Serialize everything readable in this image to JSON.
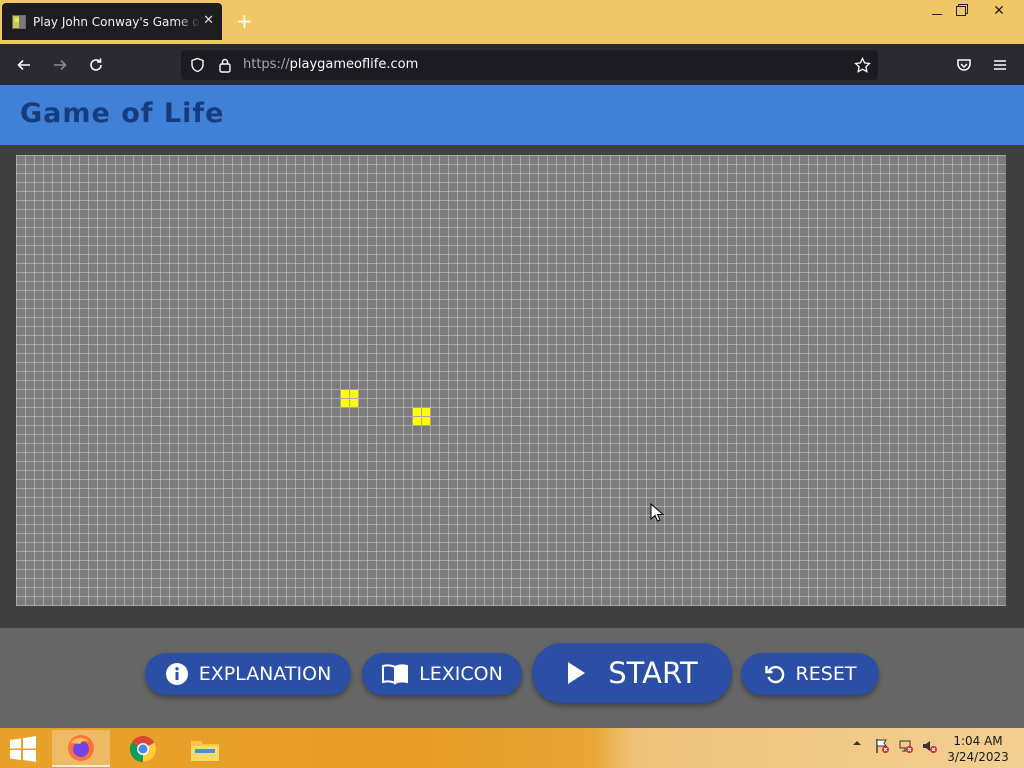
{
  "browser": {
    "tab_title": "Play John Conway's Game of Life",
    "tab_close": "✕",
    "new_tab": "+",
    "url_scheme": "https://",
    "url_host": "playgameoflife.com",
    "icons": [
      "back-icon",
      "forward-icon",
      "reload-icon",
      "shield-icon",
      "lock-icon",
      "star-icon",
      "pocket-icon",
      "menu-icon"
    ]
  },
  "window_controls": {
    "close": "✕"
  },
  "app": {
    "title": "Game of Life",
    "accent": "#4081d7",
    "cell_color": "#ffff00"
  },
  "board": {
    "live_cells": [
      {
        "col": 36,
        "row": 26
      },
      {
        "col": 37,
        "row": 26
      },
      {
        "col": 36,
        "row": 27
      },
      {
        "col": 37,
        "row": 27
      },
      {
        "col": 44,
        "row": 28
      },
      {
        "col": 45,
        "row": 28
      },
      {
        "col": 44,
        "row": 29
      },
      {
        "col": 45,
        "row": 29
      }
    ]
  },
  "controls": {
    "explanation": "EXPLANATION",
    "lexicon": "LEXICON",
    "start": "START",
    "reset": "RESET",
    "button_color": "#2b4fa4"
  },
  "taskbar": {
    "apps": [
      "firefox-icon",
      "chrome-icon",
      "file-explorer-icon"
    ],
    "time": "1:04 AM",
    "date": "3/24/2023"
  }
}
